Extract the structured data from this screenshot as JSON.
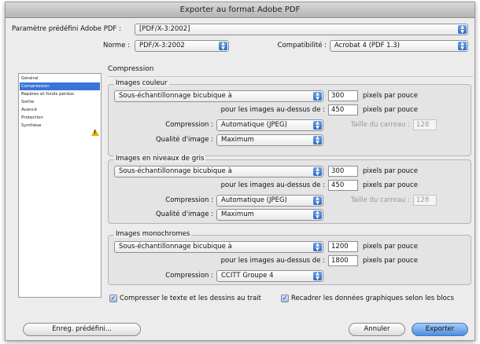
{
  "window": {
    "title": "Exporter au format Adobe PDF"
  },
  "preset": {
    "label": "Paramètre prédéfini Adobe PDF :",
    "value": "[PDF/X-3:2002]"
  },
  "standard": {
    "label": "Norme :",
    "value": "PDF/X-3:2002"
  },
  "compatibility": {
    "label": "Compatibilité :",
    "value": "Acrobat 4 (PDF 1.3)"
  },
  "sidebar": {
    "items": [
      {
        "label": "Général",
        "selected": false
      },
      {
        "label": "Compression",
        "selected": true
      },
      {
        "label": "Repères et fonds perdus",
        "selected": false
      },
      {
        "label": "Sortie",
        "selected": false
      },
      {
        "label": "Avancé",
        "selected": false
      },
      {
        "label": "Protection",
        "selected": false
      },
      {
        "label": "Synthèse",
        "selected": false,
        "warning_icon": "warning-icon"
      }
    ]
  },
  "section": {
    "title": "Compression"
  },
  "color_images": {
    "title": "Images couleur",
    "downsample": "Sous-échantillonnage bicubique à",
    "resolution": "300",
    "resolution_unit": "pixels par pouce",
    "above_label": "pour les images au-dessus de :",
    "above_value": "450",
    "above_unit": "pixels par pouce",
    "compression_label": "Compression :",
    "compression_value": "Automatique (JPEG)",
    "tile_label": "Taille du carreau :",
    "tile_value": "128",
    "quality_label": "Qualité d'image :",
    "quality_value": "Maximum"
  },
  "gray_images": {
    "title": "Images en niveaux de gris",
    "downsample": "Sous-échantillonnage bicubique à",
    "resolution": "300",
    "resolution_unit": "pixels par pouce",
    "above_label": "pour les images au-dessus de :",
    "above_value": "450",
    "above_unit": "pixels par pouce",
    "compression_label": "Compression :",
    "compression_value": "Automatique (JPEG)",
    "tile_label": "Taille du carreau :",
    "tile_value": "128",
    "quality_label": "Qualité d'image :",
    "quality_value": "Maximum"
  },
  "mono_images": {
    "title": "Images monochromes",
    "downsample": "Sous-échantillonnage bicubique à",
    "resolution": "1200",
    "resolution_unit": "pixels par pouce",
    "above_label": "pour les images au-dessus de :",
    "above_value": "1800",
    "above_unit": "pixels par pouce",
    "compression_label": "Compression :",
    "compression_value": "CCITT Groupe 4"
  },
  "options": {
    "compress_text": {
      "label": "Compresser le texte et les dessins au trait",
      "checked": true
    },
    "crop_image": {
      "label": "Recadrer les données graphiques selon les blocs",
      "checked": true
    }
  },
  "buttons": {
    "save_preset": "Enreg. prédéfini...",
    "cancel": "Annuler",
    "export": "Exporter"
  },
  "glyphs": {
    "check": "✓",
    "arrow": "▲▼",
    "warning": "!"
  }
}
